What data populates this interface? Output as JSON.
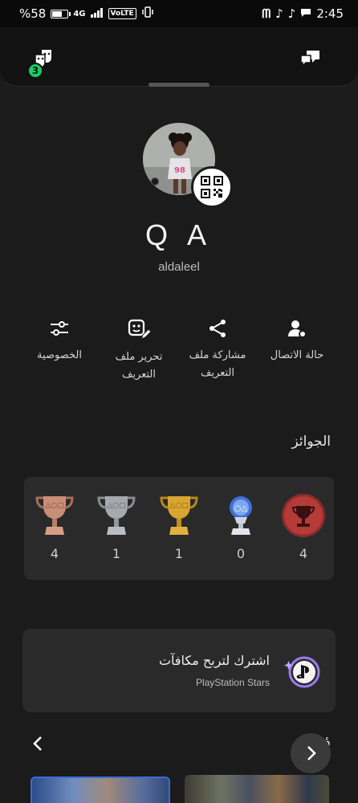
{
  "status_bar": {
    "battery_text": "%58",
    "battery_level": 0.58,
    "network": "4G",
    "volte": "VoLTE",
    "time": "2:45"
  },
  "header": {
    "friends_badge_count": "3"
  },
  "profile": {
    "display_name": "Q A",
    "online_id": "aldaleel"
  },
  "actions": [
    {
      "label": "حالة الاتصال",
      "icon": "online-status-icon"
    },
    {
      "label": "مشاركة ملف التعريف",
      "icon": "share-icon"
    },
    {
      "label": "تحرير ملف التعريف",
      "icon": "edit-profile-icon"
    },
    {
      "label": "الخصوصية",
      "icon": "privacy-sliders-icon"
    }
  ],
  "trophies": {
    "title": "الجوائز",
    "items": [
      {
        "type": "level",
        "count": "4"
      },
      {
        "type": "platinum",
        "count": "0"
      },
      {
        "type": "gold",
        "count": "1"
      },
      {
        "type": "silver",
        "count": "1"
      },
      {
        "type": "bronze",
        "count": "4"
      }
    ]
  },
  "stars": {
    "title": "اشترك لتربح مكافآت",
    "subtitle": "PlayStation Stars"
  },
  "recent": {
    "title": "ؤخرا"
  },
  "colors": {
    "background": "#1b1b1c",
    "card": "#2a2a2b",
    "badge_green": "#1ecb69"
  }
}
